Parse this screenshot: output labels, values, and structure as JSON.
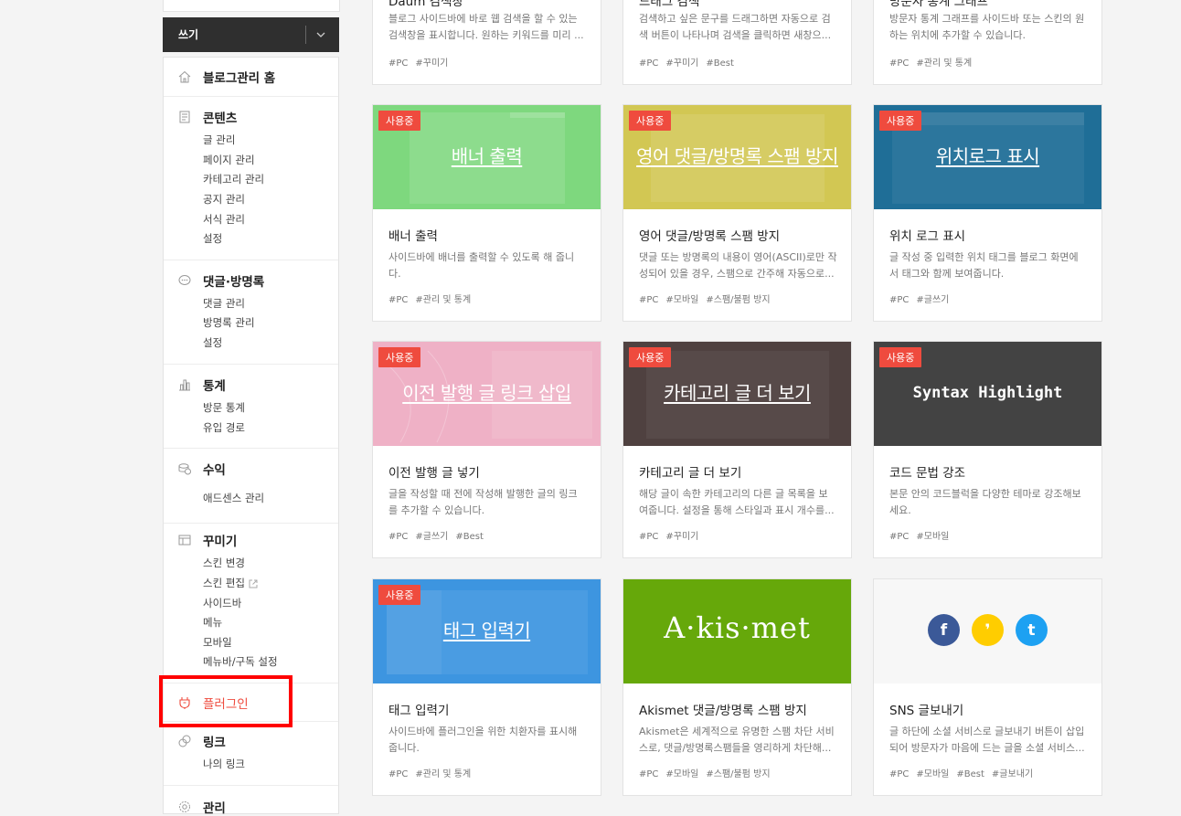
{
  "write_button": {
    "label": "쓰기"
  },
  "sidebar": {
    "home": {
      "title": "블로그관리 홈"
    },
    "content": {
      "title": "콘텐츠",
      "items": [
        "글 관리",
        "페이지 관리",
        "카테고리 관리",
        "공지 관리",
        "서식 관리",
        "설정"
      ]
    },
    "comments": {
      "title": "댓글·방명록",
      "items": [
        "댓글 관리",
        "방명록 관리",
        "설정"
      ]
    },
    "stats": {
      "title": "통계",
      "items": [
        "방문 통계",
        "유입 경로"
      ]
    },
    "revenue": {
      "title": "수익",
      "items": [
        "애드센스 관리"
      ]
    },
    "decorate": {
      "title": "꾸미기",
      "items": [
        "스킨 변경",
        "스킨 편집",
        "사이드바",
        "메뉴",
        "모바일",
        "메뉴바/구독 설정"
      ]
    },
    "plugin": {
      "title": "플러그인"
    },
    "link": {
      "title": "링크",
      "items": [
        "나의 링크"
      ]
    },
    "manage": {
      "title": "관리"
    }
  },
  "accent_color": "#ef4b3e",
  "cards_top": [
    {
      "title": "Daum 검색창",
      "desc": [
        "블로그 사이드바에 바로 웹 검색을 할 수 있는",
        "검색창을 표시합니다. 원하는 키워드를 미리 ..."
      ],
      "tags": [
        "#PC",
        "#꾸미기"
      ]
    },
    {
      "title": "드래그 검색",
      "desc": [
        "검색하고 싶은 문구를 드래그하면 자동으로 검",
        "색 버튼이 나타나며 검색을 클릭하면 새창으..."
      ],
      "tags": [
        "#PC",
        "#꾸미기",
        "#Best"
      ]
    },
    {
      "title": "방문자 통계 그래프",
      "desc": [
        "방문자 통계 그래프를 사이드바 또는 스킨의 원",
        "하는 위치에 추가할 수 있습니다."
      ],
      "tags": [
        "#PC",
        "#관리 및 통계"
      ]
    }
  ],
  "cards": [
    {
      "badge": "사용중",
      "thumb_text": "배너 출력",
      "bg": "#7ed87e",
      "title": "배너 출력",
      "desc": [
        "사이드바에 배너를 출력할 수 있도록 해 줍니",
        "다."
      ],
      "tags": [
        "#PC",
        "#관리 및 통계"
      ]
    },
    {
      "badge": "사용중",
      "thumb_text": "영어 댓글/방명록 스팸 방지",
      "bg": "#d2c753",
      "title": "영어 댓글/방명록 스팸 방지",
      "desc": [
        "댓글 또는 방명록의 내용이 영어(ASCII)로만 작",
        "성되어 있을 경우, 스팸으로 간주해 자동으로..."
      ],
      "tags": [
        "#PC",
        "#모바일",
        "#스팸/불펌 방지"
      ]
    },
    {
      "badge": "사용중",
      "thumb_text": "위치로그 표시",
      "bg": "#1f6e97",
      "title": "위치 로그 표시",
      "desc": [
        "글 작성 중 입력한 위치 태그를 블로그 화면에",
        "서 태그와 함께 보여줍니다."
      ],
      "tags": [
        "#PC",
        "#글쓰기"
      ]
    },
    {
      "badge": "사용중",
      "thumb_text": "이전 발행 글 링크 삽입",
      "bg": "#efb1c6",
      "title": "이전 발행 글 넣기",
      "desc": [
        "글을 작성할 때 전에 작성해 발행한 글의 링크",
        "를 추가할 수 있습니다."
      ],
      "tags": [
        "#PC",
        "#글쓰기",
        "#Best"
      ]
    },
    {
      "badge": "사용중",
      "thumb_text": "카테고리 글 더 보기",
      "bg": "#4f4140",
      "title": "카테고리 글 더 보기",
      "desc": [
        "해당 글이 속한 카테고리의 다른 글 목록을 보",
        "여줍니다. 설정을 통해 스타일과 표시 개수를..."
      ],
      "tags": [
        "#PC",
        "#꾸미기"
      ]
    },
    {
      "badge": "사용중",
      "thumb_text": "Syntax Highlight",
      "bg": "#434343",
      "title": "코드 문법 강조",
      "desc": [
        "본문 안의 코드블럭을 다양한 테마로 강조해보",
        "세요."
      ],
      "tags": [
        "#PC",
        "#모바일"
      ]
    },
    {
      "badge": "사용중",
      "thumb_text": "태그 입력기",
      "bg": "#3d95e0",
      "title": "태그 입력기",
      "desc": [
        "사이드바에 플러그인을 위한 치환자를 표시해",
        "줍니다."
      ],
      "tags": [
        "#PC",
        "#관리 및 통계"
      ]
    },
    {
      "thumb_text": "A·kis·met",
      "bg": "#66a80a",
      "title": "Akismet 댓글/방명록 스팸 방지",
      "desc": [
        "Akismet은 세계적으로 유명한 스팸 차단 서비",
        "스로, 댓글/방명록스팸들을 영리하게 차단해..."
      ],
      "tags": [
        "#PC",
        "#모바일",
        "#스팸/불펌 방지"
      ]
    },
    {
      "bg": "#f7f7f7",
      "title": "SNS 글보내기",
      "desc": [
        "글 하단에 소셜 서비스로 글보내기 버튼이 삽입",
        "되어 방문자가 마음에 드는 글을 소셜 서비스..."
      ],
      "tags": [
        "#PC",
        "#모바일",
        "#Best",
        "#글보내기"
      ],
      "sns": [
        "f",
        "❜",
        "t"
      ]
    }
  ]
}
